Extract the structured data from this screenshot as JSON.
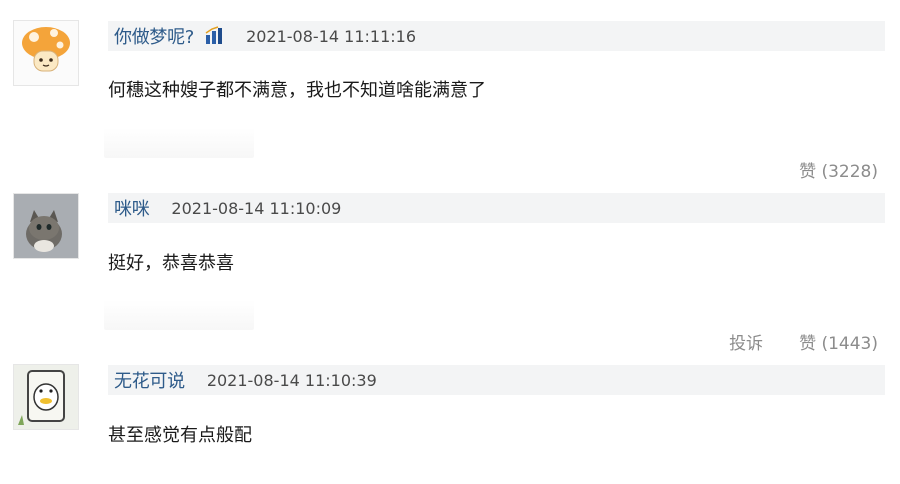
{
  "comments": [
    {
      "username": "你做梦呢?",
      "timestamp": "2021-08-14 11:11:16",
      "content": "何穗这种嫂子都不满意，我也不知道啥能满意了",
      "like_label": "赞 (3228)",
      "report_label": "",
      "avatar_icon": "mushroom-avatar",
      "has_vip_badge": true
    },
    {
      "username": "咪咪",
      "timestamp": "2021-08-14 11:10:09",
      "content": "挺好，恭喜恭喜",
      "like_label": "赞 (1443)",
      "report_label": "投诉",
      "avatar_icon": "kitten-avatar",
      "has_vip_badge": false
    },
    {
      "username": "无花可说",
      "timestamp": "2021-08-14 11:10:39",
      "content": "甚至感觉有点般配",
      "like_label": "",
      "report_label": "",
      "avatar_icon": "penguin-sticker-avatar",
      "has_vip_badge": false
    }
  ],
  "colors": {
    "username": "#2e5b8a",
    "header_bg": "#f3f4f5",
    "action_text": "#8c8c8c"
  }
}
